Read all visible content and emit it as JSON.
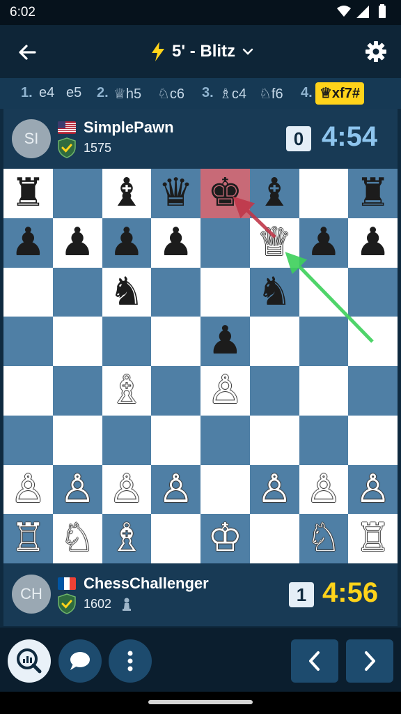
{
  "status": {
    "time": "6:02"
  },
  "header": {
    "title": "5' - Blitz"
  },
  "moves": {
    "m1_num": "1.",
    "m1_w": "e4",
    "m1_b": "e5",
    "m2_num": "2.",
    "m2_w": "♕h5",
    "m2_b": "♘c6",
    "m3_num": "3.",
    "m3_w": "♗c4",
    "m3_b": "♘f6",
    "m4_num": "4.",
    "m4_w": "♕xf7#"
  },
  "top_player": {
    "initials": "SI",
    "name": "SimplePawn",
    "rating": "1575",
    "score": "0",
    "clock": "4:54",
    "clock_color": "#8ec5ee"
  },
  "bottom_player": {
    "initials": "CH",
    "name": "ChessChallenger",
    "rating": "1602",
    "score": "1",
    "clock": "4:56",
    "clock_color": "#ffd31a"
  },
  "board": {
    "rank8": [
      "♜",
      "",
      "♝",
      "♛",
      "♚",
      "♝",
      "",
      "♜"
    ],
    "rank7": [
      "♟",
      "♟",
      "♟",
      "♟",
      "",
      "♕",
      "♟",
      "♟"
    ],
    "rank6": [
      "",
      "",
      "♞",
      "",
      "",
      "♞",
      "",
      ""
    ],
    "rank5": [
      "",
      "",
      "",
      "",
      "♟",
      "",
      "",
      ""
    ],
    "rank4": [
      "",
      "",
      "♗",
      "",
      "♙",
      "",
      "",
      ""
    ],
    "rank3": [
      "",
      "",
      "",
      "",
      "",
      "",
      "",
      ""
    ],
    "rank2": [
      "♙",
      "♙",
      "♙",
      "♙",
      "",
      "♙",
      "♙",
      "♙"
    ],
    "rank1": [
      "♖",
      "♘",
      "♗",
      "",
      "♔",
      "",
      "♘",
      "♖"
    ],
    "colors": {
      "rank8": [
        "b",
        "",
        "b",
        "b",
        "b",
        "b",
        "",
        "b"
      ],
      "rank7": [
        "b",
        "b",
        "b",
        "b",
        "",
        "w",
        "b",
        "b"
      ],
      "rank6": [
        "",
        "",
        "b",
        "",
        "",
        "b",
        "",
        ""
      ],
      "rank5": [
        "",
        "",
        "",
        "",
        "b",
        "",
        "",
        ""
      ],
      "rank4": [
        "",
        "",
        "w",
        "",
        "w",
        "",
        "",
        ""
      ],
      "rank3": [
        "",
        "",
        "",
        "",
        "",
        "",
        "",
        ""
      ],
      "rank2": [
        "w",
        "w",
        "w",
        "w",
        "",
        "w",
        "w",
        "w"
      ],
      "rank1": [
        "w",
        "w",
        "w",
        "",
        "w",
        "",
        "w",
        "w"
      ]
    },
    "light_color": "#ffffff",
    "dark_color": "#4f7fa5",
    "check_color": "#c86a77"
  },
  "colors": {
    "accent": "#ffd31a",
    "background": "#0f2a3f"
  },
  "icons": {
    "back": "arrow-left-icon",
    "bolt": "lightning-icon",
    "chevron": "chevron-down-icon",
    "settings": "gear-icon",
    "analysis": "analysis-search-icon",
    "chat": "chat-bubble-icon",
    "more": "more-vertical-icon",
    "prev": "chevron-left-icon",
    "next": "chevron-right-icon"
  }
}
